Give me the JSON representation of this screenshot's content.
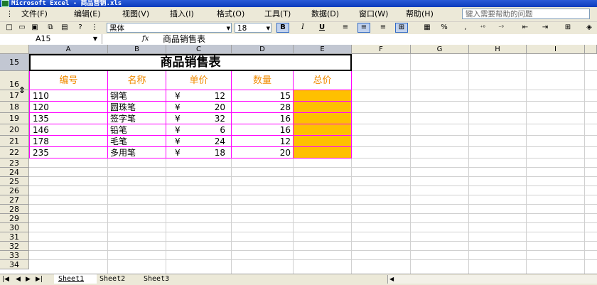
{
  "window": {
    "title": "Microsoft Excel - 商品营销.xls"
  },
  "menu": {
    "items": [
      "文件(F)",
      "编辑(E)",
      "视图(V)",
      "插入(I)",
      "格式(O)",
      "工具(T)",
      "数据(D)",
      "窗口(W)",
      "帮助(H)"
    ],
    "help_placeholder": "键入需要帮助的问题"
  },
  "toolbar": {
    "font": "黑体",
    "size": "18",
    "bold": "B",
    "italic": "I",
    "underline": "U",
    "percent": "%",
    "comma": ","
  },
  "formula": {
    "cell_ref": "A15",
    "fx": "fx",
    "content": "商品销售表"
  },
  "grid": {
    "columns": [
      "A",
      "B",
      "C",
      "D",
      "E",
      "F",
      "G",
      "H",
      "I"
    ],
    "rows": [
      "15",
      "16",
      "17",
      "18",
      "19",
      "20",
      "21",
      "22",
      "23",
      "24",
      "25",
      "26",
      "27",
      "28",
      "29",
      "30",
      "31",
      "32",
      "33",
      "34"
    ]
  },
  "table": {
    "title": "商品销售表",
    "headers": [
      "编号",
      "名称",
      "单价",
      "数量",
      "总价"
    ],
    "currency": "¥",
    "rows": [
      {
        "id": "110",
        "name": "钢笔",
        "price": "12",
        "qty": "15"
      },
      {
        "id": "120",
        "name": "圆珠笔",
        "price": "20",
        "qty": "28"
      },
      {
        "id": "135",
        "name": "签字笔",
        "price": "32",
        "qty": "16"
      },
      {
        "id": "146",
        "name": "铅笔",
        "price": "6",
        "qty": "16"
      },
      {
        "id": "178",
        "name": "毛笔",
        "price": "24",
        "qty": "12"
      },
      {
        "id": "235",
        "name": "多用笔",
        "price": "18",
        "qty": "20"
      }
    ]
  },
  "sheets": {
    "tabs": [
      "Sheet1",
      "Sheet2",
      "Sheet3"
    ],
    "active": "Sheet1"
  },
  "colors": {
    "header_text": "#f08a00",
    "total_fill": "#ffc000",
    "border": "#ff00ff",
    "selection": "#00a000"
  }
}
